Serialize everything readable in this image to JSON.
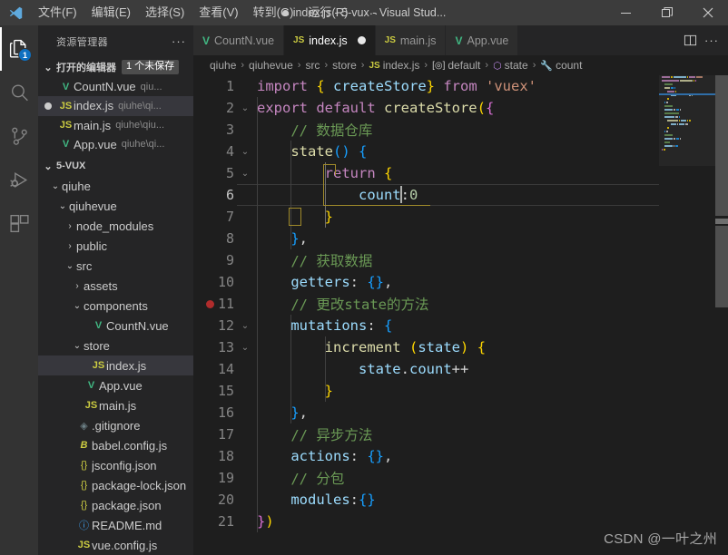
{
  "window": {
    "title": "index.js - 5-vux - Visual Stud...",
    "dirty_indicator": "●",
    "minimize": "—",
    "maximize": "❐",
    "close": "✕"
  },
  "menubar": {
    "items": [
      {
        "label": "文件(F)"
      },
      {
        "label": "编辑(E)"
      },
      {
        "label": "选择(S)"
      },
      {
        "label": "查看(V)"
      },
      {
        "label": "转到(G)"
      },
      {
        "label": "运行(R)"
      }
    ],
    "overflow": "···"
  },
  "activitybar": {
    "items": [
      {
        "name": "explorer",
        "icon": "files-icon",
        "badge": "1",
        "active": true
      },
      {
        "name": "search",
        "icon": "search-icon",
        "badge": "",
        "active": false
      },
      {
        "name": "source-control",
        "icon": "source-control-icon",
        "badge": "",
        "active": false
      },
      {
        "name": "run-debug",
        "icon": "run-debug-icon",
        "badge": "",
        "active": false
      },
      {
        "name": "extensions",
        "icon": "extensions-icon",
        "badge": "",
        "active": false
      }
    ]
  },
  "sidebar": {
    "title": "资源管理器",
    "more": "···",
    "open_editors": {
      "label": "打开的编辑器",
      "badge": "1 个未保存",
      "twisty": "⌄",
      "items": [
        {
          "icon": "vue",
          "name": "CountN.vue",
          "desc": "qiu...",
          "dirty": false,
          "selected": false
        },
        {
          "icon": "js",
          "name": "index.js",
          "desc": "qiuhe\\qi...",
          "dirty": true,
          "selected": true
        },
        {
          "icon": "js",
          "name": "main.js",
          "desc": "qiuhe\\qiu...",
          "dirty": false,
          "selected": false
        },
        {
          "icon": "vue",
          "name": "App.vue",
          "desc": "qiuhe\\qi...",
          "dirty": false,
          "selected": false
        }
      ]
    },
    "project": {
      "label": "5-VUX",
      "twisty": "⌄",
      "tree": [
        {
          "depth": 1,
          "chev": "⌄",
          "icon": "folder",
          "name": "qiuhe",
          "selected": false
        },
        {
          "depth": 2,
          "chev": "⌄",
          "icon": "folder",
          "name": "qiuhevue",
          "selected": false
        },
        {
          "depth": 3,
          "chev": "›",
          "icon": "folder",
          "name": "node_modules",
          "selected": false
        },
        {
          "depth": 3,
          "chev": "›",
          "icon": "folder",
          "name": "public",
          "selected": false
        },
        {
          "depth": 3,
          "chev": "⌄",
          "icon": "folder",
          "name": "src",
          "selected": false
        },
        {
          "depth": 4,
          "chev": "›",
          "icon": "folder",
          "name": "assets",
          "selected": false
        },
        {
          "depth": 4,
          "chev": "⌄",
          "icon": "folder",
          "name": "components",
          "selected": false
        },
        {
          "depth": 5,
          "chev": "",
          "icon": "vue",
          "name": "CountN.vue",
          "selected": false
        },
        {
          "depth": 4,
          "chev": "⌄",
          "icon": "folder",
          "name": "store",
          "selected": false
        },
        {
          "depth": 5,
          "chev": "",
          "icon": "js",
          "name": "index.js",
          "selected": true
        },
        {
          "depth": 4,
          "chev": "",
          "icon": "vue",
          "name": "App.vue",
          "selected": false
        },
        {
          "depth": 4,
          "chev": "",
          "icon": "js",
          "name": "main.js",
          "selected": false
        },
        {
          "depth": 3,
          "chev": "",
          "icon": "git",
          "name": ".gitignore",
          "selected": false
        },
        {
          "depth": 3,
          "chev": "",
          "icon": "babel",
          "name": "babel.config.js",
          "selected": false
        },
        {
          "depth": 3,
          "chev": "",
          "icon": "json",
          "name": "jsconfig.json",
          "selected": false
        },
        {
          "depth": 3,
          "chev": "",
          "icon": "json",
          "name": "package-lock.json",
          "selected": false
        },
        {
          "depth": 3,
          "chev": "",
          "icon": "json",
          "name": "package.json",
          "selected": false
        },
        {
          "depth": 3,
          "chev": "",
          "icon": "md",
          "name": "README.md",
          "selected": false
        },
        {
          "depth": 3,
          "chev": "",
          "icon": "js",
          "name": "vue.config.js",
          "selected": false
        }
      ]
    }
  },
  "tabs": {
    "items": [
      {
        "icon": "vue",
        "label": "CountN.vue",
        "active": false,
        "dirty": false
      },
      {
        "icon": "js",
        "label": "index.js",
        "active": true,
        "dirty": true
      },
      {
        "icon": "js",
        "label": "main.js",
        "active": false,
        "dirty": false
      },
      {
        "icon": "vue",
        "label": "App.vue",
        "active": false,
        "dirty": false
      }
    ],
    "actions": {
      "split": "split-editor-icon",
      "more": "···"
    }
  },
  "breadcrumb": {
    "separator": "›",
    "items": [
      {
        "label": "qiuhe",
        "icon": ""
      },
      {
        "label": "qiuhevue",
        "icon": ""
      },
      {
        "label": "src",
        "icon": ""
      },
      {
        "label": "store",
        "icon": ""
      },
      {
        "label": "index.js",
        "icon": "js"
      },
      {
        "label": "default",
        "icon": "symbol-object"
      },
      {
        "label": "state",
        "icon": "symbol-method"
      },
      {
        "label": "count",
        "icon": "symbol-property"
      }
    ]
  },
  "editor": {
    "language": "javascript",
    "cursor_line": 6,
    "breakpoint_line": 11,
    "folded_lines": [
      2,
      4,
      5,
      12,
      13
    ],
    "lines": [
      {
        "n": 1,
        "fold": "",
        "tokens": [
          {
            "t": "import ",
            "c": "t-kw"
          },
          {
            "t": "{ ",
            "c": "t-p1"
          },
          {
            "t": "createStore",
            "c": "t-var"
          },
          {
            "t": "}",
            "c": "t-p1"
          },
          {
            "t": " from ",
            "c": "t-kw"
          },
          {
            "t": "'vuex'",
            "c": "t-str"
          }
        ]
      },
      {
        "n": 2,
        "fold": "⌄",
        "tokens": [
          {
            "t": "export default ",
            "c": "t-kw"
          },
          {
            "t": "createStore",
            "c": "t-fn"
          },
          {
            "t": "(",
            "c": "t-p1"
          },
          {
            "t": "{",
            "c": "t-p2"
          }
        ]
      },
      {
        "n": 3,
        "fold": "",
        "tokens": [
          {
            "t": "    // 数据仓库",
            "c": "t-cmt"
          }
        ]
      },
      {
        "n": 4,
        "fold": "⌄",
        "tokens": [
          {
            "t": "    ",
            "c": "t-plain"
          },
          {
            "t": "state",
            "c": "t-fn"
          },
          {
            "t": "()",
            "c": "t-p3"
          },
          {
            "t": " ",
            "c": "t-plain"
          },
          {
            "t": "{",
            "c": "t-p3"
          }
        ]
      },
      {
        "n": 5,
        "fold": "⌄",
        "tokens": [
          {
            "t": "        ",
            "c": "t-plain"
          },
          {
            "t": "return",
            "c": "t-kw"
          },
          {
            "t": " ",
            "c": "t-plain"
          },
          {
            "t": "{",
            "c": "t-p1"
          }
        ]
      },
      {
        "n": 6,
        "fold": "",
        "tokens": [
          {
            "t": "            ",
            "c": "t-plain"
          },
          {
            "t": "count",
            "c": "t-var"
          },
          {
            "t": "__CURSOR__",
            "c": "cursor"
          },
          {
            "t": ":",
            "c": "t-plain"
          },
          {
            "t": "0",
            "c": "t-num"
          }
        ]
      },
      {
        "n": 7,
        "fold": "",
        "tokens": [
          {
            "t": "        ",
            "c": "t-plain"
          },
          {
            "t": "}",
            "c": "t-p1"
          }
        ]
      },
      {
        "n": 8,
        "fold": "",
        "tokens": [
          {
            "t": "    ",
            "c": "t-plain"
          },
          {
            "t": "}",
            "c": "t-p3"
          },
          {
            "t": ",",
            "c": "t-plain"
          }
        ]
      },
      {
        "n": 9,
        "fold": "",
        "tokens": [
          {
            "t": "    // 获取数据",
            "c": "t-cmt"
          }
        ]
      },
      {
        "n": 10,
        "fold": "",
        "tokens": [
          {
            "t": "    ",
            "c": "t-plain"
          },
          {
            "t": "getters",
            "c": "t-var"
          },
          {
            "t": ": ",
            "c": "t-plain"
          },
          {
            "t": "{}",
            "c": "t-p3"
          },
          {
            "t": ",",
            "c": "t-plain"
          }
        ]
      },
      {
        "n": 11,
        "fold": "",
        "tokens": [
          {
            "t": "    // 更改state的方法",
            "c": "t-cmt"
          }
        ]
      },
      {
        "n": 12,
        "fold": "⌄",
        "tokens": [
          {
            "t": "    ",
            "c": "t-plain"
          },
          {
            "t": "mutations",
            "c": "t-var"
          },
          {
            "t": ": ",
            "c": "t-plain"
          },
          {
            "t": "{",
            "c": "t-p3"
          }
        ]
      },
      {
        "n": 13,
        "fold": "⌄",
        "tokens": [
          {
            "t": "        ",
            "c": "t-plain"
          },
          {
            "t": "increment",
            "c": "t-fn"
          },
          {
            "t": " ",
            "c": "t-plain"
          },
          {
            "t": "(",
            "c": "t-p1"
          },
          {
            "t": "state",
            "c": "t-var"
          },
          {
            "t": ")",
            "c": "t-p1"
          },
          {
            "t": " ",
            "c": "t-plain"
          },
          {
            "t": "{",
            "c": "t-p1"
          }
        ]
      },
      {
        "n": 14,
        "fold": "",
        "tokens": [
          {
            "t": "            ",
            "c": "t-plain"
          },
          {
            "t": "state",
            "c": "t-var"
          },
          {
            "t": ".",
            "c": "t-plain"
          },
          {
            "t": "count",
            "c": "t-var"
          },
          {
            "t": "++",
            "c": "t-plain"
          }
        ]
      },
      {
        "n": 15,
        "fold": "",
        "tokens": [
          {
            "t": "        ",
            "c": "t-plain"
          },
          {
            "t": "}",
            "c": "t-p1"
          }
        ]
      },
      {
        "n": 16,
        "fold": "",
        "tokens": [
          {
            "t": "    ",
            "c": "t-plain"
          },
          {
            "t": "}",
            "c": "t-p3"
          },
          {
            "t": ",",
            "c": "t-plain"
          }
        ]
      },
      {
        "n": 17,
        "fold": "",
        "tokens": [
          {
            "t": "    // 异步方法",
            "c": "t-cmt"
          }
        ]
      },
      {
        "n": 18,
        "fold": "",
        "tokens": [
          {
            "t": "    ",
            "c": "t-plain"
          },
          {
            "t": "actions",
            "c": "t-var"
          },
          {
            "t": ": ",
            "c": "t-plain"
          },
          {
            "t": "{}",
            "c": "t-p3"
          },
          {
            "t": ",",
            "c": "t-plain"
          }
        ]
      },
      {
        "n": 19,
        "fold": "",
        "tokens": [
          {
            "t": "    // 分包",
            "c": "t-cmt"
          }
        ]
      },
      {
        "n": 20,
        "fold": "",
        "tokens": [
          {
            "t": "    ",
            "c": "t-plain"
          },
          {
            "t": "modules",
            "c": "t-var"
          },
          {
            "t": ":",
            "c": "t-plain"
          },
          {
            "t": "{}",
            "c": "t-p3"
          }
        ]
      },
      {
        "n": 21,
        "fold": "",
        "tokens": [
          {
            "t": "",
            "c": "t-plain"
          },
          {
            "t": "}",
            "c": "t-p2"
          },
          {
            "t": ")",
            "c": "t-p1"
          }
        ]
      }
    ]
  },
  "watermark": {
    "text": "CSDN @一叶之州"
  },
  "colors": {
    "accent": "#007acc",
    "editor_bg": "#1e1e1e",
    "sidebar_bg": "#252526",
    "activitybar_bg": "#333333",
    "titlebar_bg": "#3c3c3c",
    "badge_bg": "#0e70c0",
    "breakpoint": "#b02c2c",
    "vue_green": "#41b883",
    "js_yellow": "#cbcb41"
  }
}
